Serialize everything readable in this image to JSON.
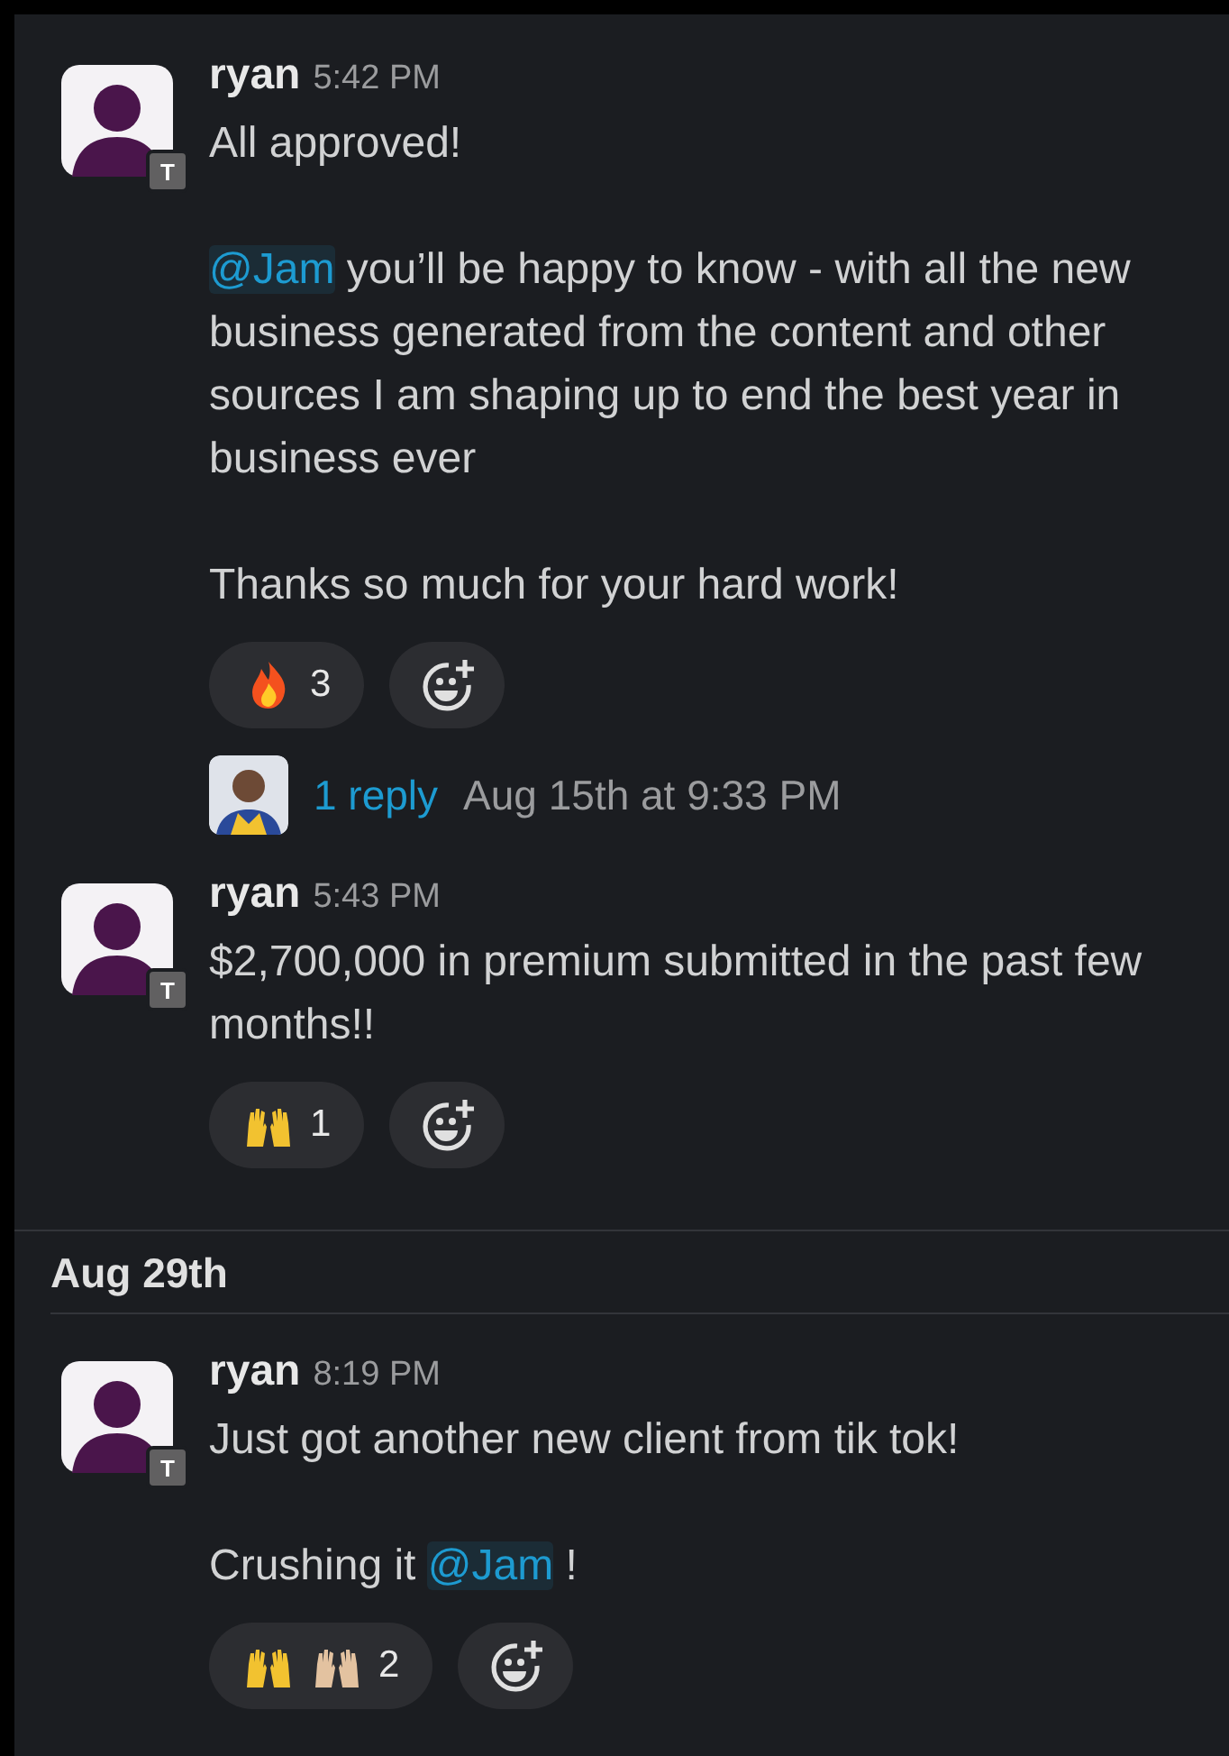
{
  "items": [
    {
      "kind": "message",
      "author": "ryan",
      "time": "5:42 PM",
      "badge": "T",
      "paragraphs": [
        [
          {
            "text": "All approved!"
          }
        ],
        [
          {
            "text": "@Jam",
            "kind": "mention"
          },
          {
            "text": " you’ll be happy to know - with all the new business generated from the content and other sources I am shaping up to end the best year in business ever"
          }
        ],
        [
          {
            "text": "Thanks so much for your hard work!"
          }
        ]
      ],
      "reactions": [
        {
          "emojis": [
            {
              "kind": "fire"
            }
          ],
          "count": "3"
        }
      ],
      "thread": {
        "replies": "1 reply",
        "last_reply": "Aug 15th at 9:33 PM"
      }
    },
    {
      "kind": "message",
      "author": "ryan",
      "time": "5:43 PM",
      "badge": "T",
      "paragraphs": [
        [
          {
            "text": "$2,700,000 in premium submitted in the past few months!!"
          }
        ]
      ],
      "reactions": [
        {
          "emojis": [
            {
              "kind": "raised-hands",
              "color": "#f2c230"
            }
          ],
          "count": "1"
        }
      ]
    },
    {
      "kind": "date",
      "label": "Aug 29th"
    },
    {
      "kind": "message",
      "author": "ryan",
      "time": "8:19 PM",
      "badge": "T",
      "paragraphs": [
        [
          {
            "text": "Just got another new client from tik tok!"
          }
        ],
        [
          {
            "text": "Crushing it "
          },
          {
            "text": "@Jam",
            "kind": "mention"
          },
          {
            "text": " !"
          }
        ]
      ],
      "reactions": [
        {
          "emojis": [
            {
              "kind": "raised-hands",
              "color": "#f2c230"
            },
            {
              "kind": "raised-hands",
              "color": "#e3c2a0"
            }
          ],
          "count": "2"
        }
      ]
    }
  ]
}
